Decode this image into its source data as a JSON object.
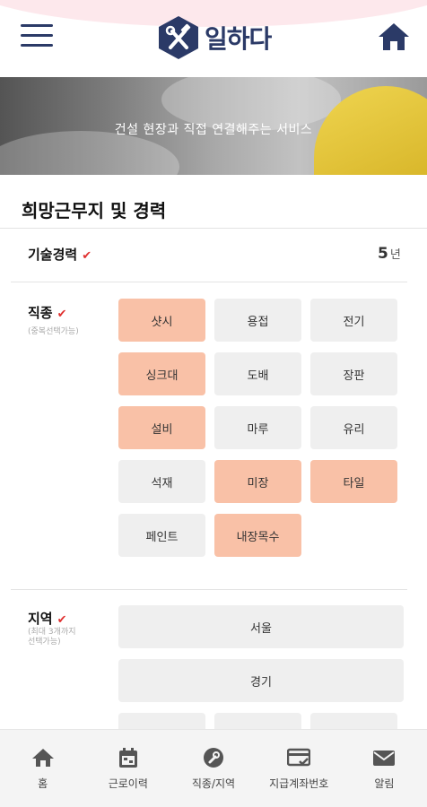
{
  "header": {
    "logo_text": "일하다",
    "icons": {
      "menu": "hamburger-menu-icon",
      "home": "home-icon",
      "logo": "tools-hexagon-logo"
    }
  },
  "banner": {
    "text": "건설 현장과 직접 연결해주는 서비스"
  },
  "section": {
    "title": "희망근무지 및 경력"
  },
  "experience": {
    "label": "기술경력",
    "value": "5",
    "unit": "년"
  },
  "trade": {
    "label": "직종",
    "sub_label": "(중복선택가능)",
    "chips": [
      {
        "label": "샷시",
        "selected": true
      },
      {
        "label": "용접",
        "selected": false
      },
      {
        "label": "전기",
        "selected": false
      },
      {
        "label": "싱크대",
        "selected": true
      },
      {
        "label": "도배",
        "selected": false
      },
      {
        "label": "장판",
        "selected": false
      },
      {
        "label": "설비",
        "selected": true
      },
      {
        "label": "마루",
        "selected": false
      },
      {
        "label": "유리",
        "selected": false
      },
      {
        "label": "석재",
        "selected": false
      },
      {
        "label": "미장",
        "selected": true
      },
      {
        "label": "타일",
        "selected": true
      },
      {
        "label": "페인트",
        "selected": false
      },
      {
        "label": "내장목수",
        "selected": true
      }
    ]
  },
  "region": {
    "label": "지역",
    "sub_label_1": "(최대 3개까지",
    "sub_label_2": "선택가능)",
    "chips": [
      {
        "label": "서울"
      },
      {
        "label": "경기"
      }
    ]
  },
  "nav": [
    {
      "label": "홈",
      "icon": "home-icon"
    },
    {
      "label": "근로이력",
      "icon": "calendar-icon"
    },
    {
      "label": "직종/지역",
      "icon": "wrench-icon"
    },
    {
      "label": "지급계좌번호",
      "icon": "credit-card-icon"
    },
    {
      "label": "알림",
      "icon": "mail-icon"
    }
  ],
  "colors": {
    "primary": "#2b3a67",
    "selected_chip": "#f9c1a7",
    "chip": "#efefef",
    "check": "#e0302f"
  }
}
